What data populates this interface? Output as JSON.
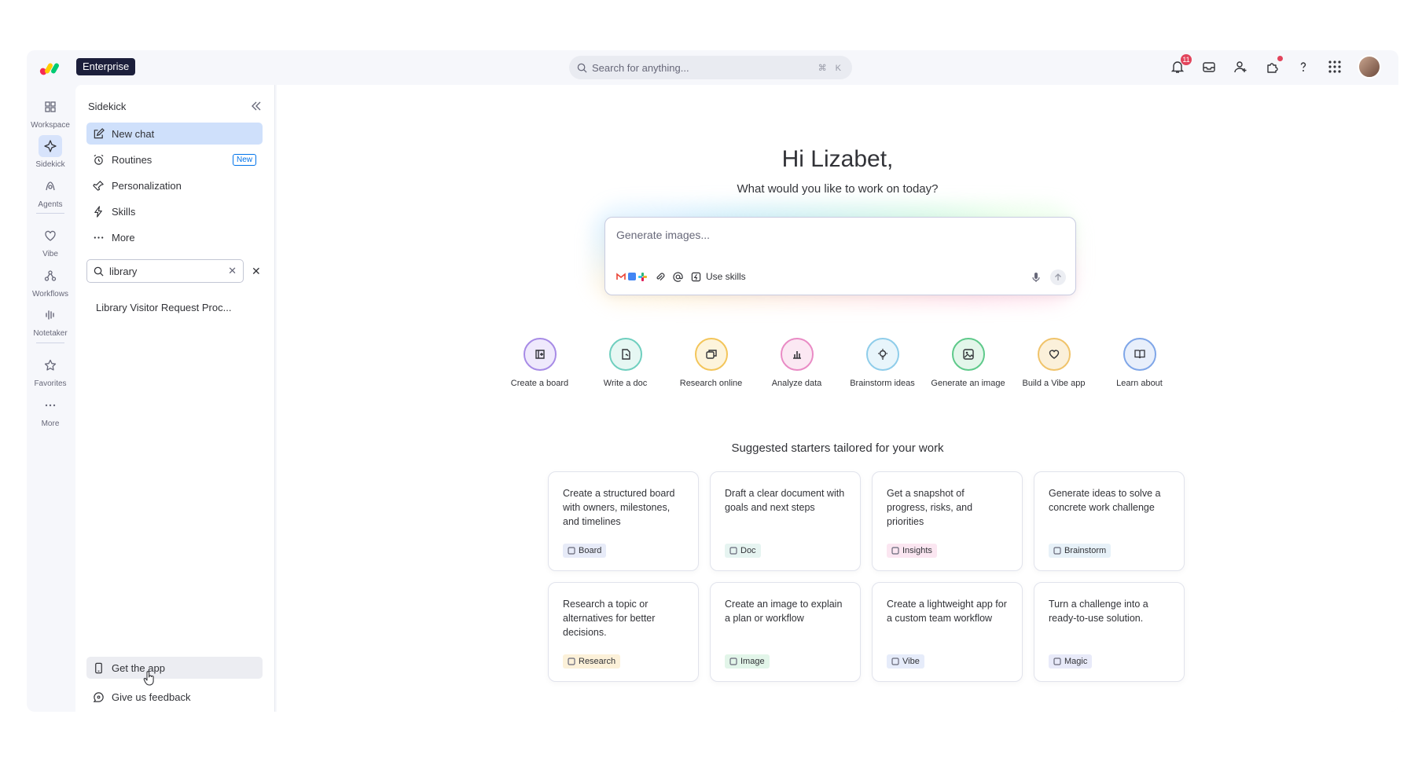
{
  "topbar": {
    "brand_badge": "Enterprise",
    "search_placeholder": "Search for anything...",
    "search_shortcut": "⌘ K",
    "notification_count": "11"
  },
  "rail": {
    "items": [
      {
        "label": "Workspace",
        "icon": "grid-icon"
      },
      {
        "label": "Sidekick",
        "icon": "sparkle-icon"
      },
      {
        "label": "Agents",
        "icon": "agent-icon"
      },
      {
        "label": "Vibe",
        "icon": "heart-icon"
      },
      {
        "label": "Workflows",
        "icon": "workflow-icon"
      },
      {
        "label": "Notetaker",
        "icon": "waveform-icon"
      },
      {
        "label": "Favorites",
        "icon": "star-icon"
      },
      {
        "label": "More",
        "icon": "dots-icon"
      }
    ]
  },
  "panel": {
    "title": "Sidekick",
    "nav": [
      {
        "label": "New chat"
      },
      {
        "label": "Routines",
        "tag": "New"
      },
      {
        "label": "Personalization"
      },
      {
        "label": "Skills"
      },
      {
        "label": "More"
      }
    ],
    "search_value": "library",
    "result": "Library Visitor Request Proc...",
    "footer": [
      {
        "label": "Get the app"
      },
      {
        "label": "Give us feedback"
      }
    ]
  },
  "main": {
    "greeting": "Hi Lizabet,",
    "subtitle": "What would you like to work on today?",
    "prompt_placeholder": "Generate images...",
    "use_skills": "Use skills",
    "actions": [
      {
        "label": "Create a board",
        "color": "#a78be6",
        "bg": "#efe9fc"
      },
      {
        "label": "Write a doc",
        "color": "#6fcfbf",
        "bg": "#e6f7f3"
      },
      {
        "label": "Research online",
        "color": "#f3c55a",
        "bg": "#fdf4dc"
      },
      {
        "label": "Analyze data",
        "color": "#e98bc5",
        "bg": "#fbe8f3"
      },
      {
        "label": "Brainstorm ideas",
        "color": "#8fcdea",
        "bg": "#e8f5fb"
      },
      {
        "label": "Generate an image",
        "color": "#5ec98a",
        "bg": "#e3f6ea"
      },
      {
        "label": "Build a Vibe app",
        "color": "#f0c36a",
        "bg": "#fbf0da"
      },
      {
        "label": "Learn about",
        "color": "#7fa6e8",
        "bg": "#e8effb"
      }
    ],
    "starters_title": "Suggested starters tailored for your work",
    "cards": [
      {
        "text": "Create a structured board with owners, milestones, and timelines",
        "tag": "Board",
        "tag_bg": "#e7ebf8"
      },
      {
        "text": "Draft a clear document with goals and next steps",
        "tag": "Doc",
        "tag_bg": "#e6f4f1"
      },
      {
        "text": "Get a snapshot of progress, risks, and priorities",
        "tag": "Insights",
        "tag_bg": "#fbe6f1"
      },
      {
        "text": "Generate ideas to solve a concrete work challenge",
        "tag": "Brainstorm",
        "tag_bg": "#e7f1f8"
      },
      {
        "text": "Research a topic or alternatives for better decisions.",
        "tag": "Research",
        "tag_bg": "#fcf1d9"
      },
      {
        "text": "Create an image to explain a plan or workflow",
        "tag": "Image",
        "tag_bg": "#e2f5e9"
      },
      {
        "text": "Create a lightweight app for a custom team workflow",
        "tag": "Vibe",
        "tag_bg": "#e6ecfa"
      },
      {
        "text": "Turn a challenge into a ready-to-use solution.",
        "tag": "Magic",
        "tag_bg": "#e8eaf9"
      }
    ]
  }
}
